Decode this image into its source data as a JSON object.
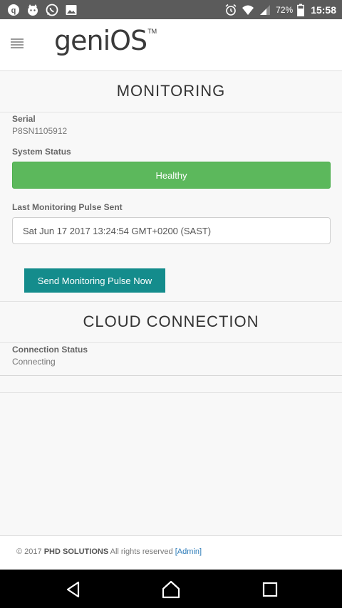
{
  "statusbar": {
    "left_icons": [
      "app-q-icon",
      "app-cat-icon",
      "whatsapp-icon",
      "image-icon"
    ],
    "right_icons": [
      "alarm-icon",
      "wifi-icon",
      "signal-icon",
      "battery-icon"
    ],
    "battery": "72%",
    "time": "15:58"
  },
  "header": {
    "logo_text": "geniOS",
    "logo_tm": "TM"
  },
  "monitoring": {
    "title": "MONITORING",
    "serial_label": "Serial",
    "serial_value": "P8SN1105912",
    "system_status_label": "System Status",
    "system_status_value": "Healthy",
    "last_pulse_label": "Last Monitoring Pulse Sent",
    "last_pulse_value": "Sat Jun 17 2017 13:24:54 GMT+0200 (SAST)",
    "send_button": "Send Monitoring Pulse Now"
  },
  "cloud": {
    "title": "CLOUD CONNECTION",
    "connection_status_label": "Connection Status",
    "connection_status_value": "Connecting"
  },
  "footer": {
    "copyright": "© 2017",
    "company": "PHD SOLUTIONS",
    "rights": "All rights reserved",
    "admin_link": "[Admin]"
  },
  "colors": {
    "healthy": "#5cb85c",
    "button": "#148c8c",
    "link": "#2a7ab8"
  }
}
